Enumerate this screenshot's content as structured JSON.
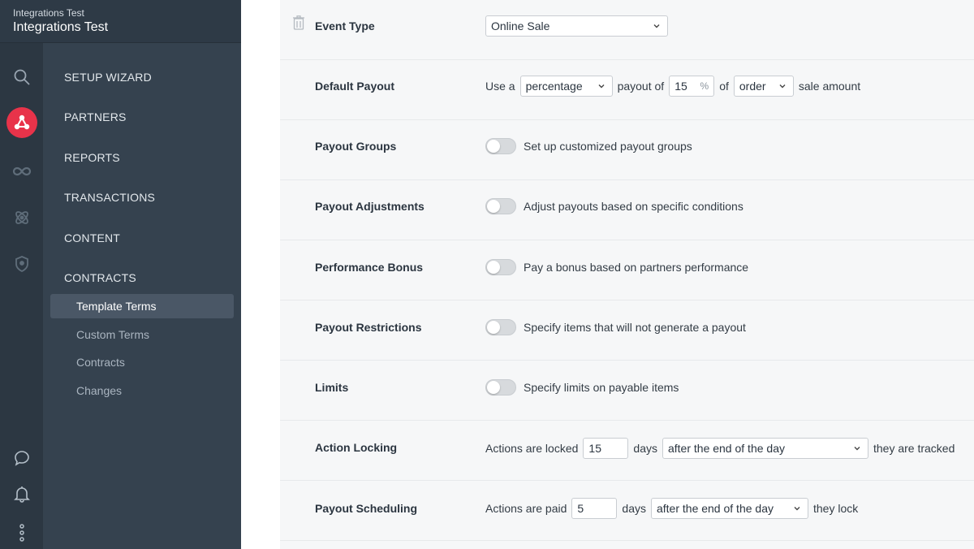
{
  "account": {
    "subtitle": "Integrations Test",
    "title": "Integrations Test"
  },
  "nav": {
    "items": [
      {
        "label": "SETUP WIZARD"
      },
      {
        "label": "PARTNERS"
      },
      {
        "label": "REPORTS"
      },
      {
        "label": "TRANSACTIONS"
      },
      {
        "label": "CONTENT"
      },
      {
        "label": "CONTRACTS"
      }
    ],
    "sub_items": [
      {
        "label": "Template Terms",
        "active": true
      },
      {
        "label": "Custom Terms"
      },
      {
        "label": "Contracts"
      },
      {
        "label": "Changes"
      }
    ]
  },
  "rail_icons": [
    "search-icon",
    "partners-network-icon",
    "infinity-icon",
    "atom-icon",
    "shield-icon",
    "chat-icon",
    "bell-icon",
    "more-vertical-icon"
  ],
  "colors": {
    "accent": "#e8334a",
    "sidebar": "#35424f",
    "rail": "#2c3742"
  },
  "form": {
    "event_type": {
      "label": "Event Type",
      "value": "Online Sale"
    },
    "default_payout": {
      "label": "Default Payout",
      "prefix": "Use a",
      "type_value": "percentage",
      "mid": "payout of",
      "amount": "15",
      "unit": "%",
      "of": "of",
      "basis_value": "order",
      "suffix": "sale amount"
    },
    "payout_groups": {
      "label": "Payout Groups",
      "text": "Set up customized payout groups"
    },
    "payout_adjustments": {
      "label": "Payout Adjustments",
      "text": "Adjust payouts based on specific conditions"
    },
    "performance_bonus": {
      "label": "Performance Bonus",
      "text": "Pay a bonus based on partners performance"
    },
    "payout_restrictions": {
      "label": "Payout Restrictions",
      "text": "Specify items that will not generate a payout"
    },
    "limits": {
      "label": "Limits",
      "text": "Specify limits on payable items"
    },
    "action_locking": {
      "label": "Action Locking",
      "prefix": "Actions are locked",
      "days_value": "15",
      "days_label": "days",
      "timing_value": "after the end of the day",
      "suffix": "they are tracked"
    },
    "payout_scheduling": {
      "label": "Payout Scheduling",
      "prefix": "Actions are paid",
      "days_value": "5",
      "days_label": "days",
      "timing_value": "after the end of the day",
      "suffix": "they lock"
    }
  }
}
